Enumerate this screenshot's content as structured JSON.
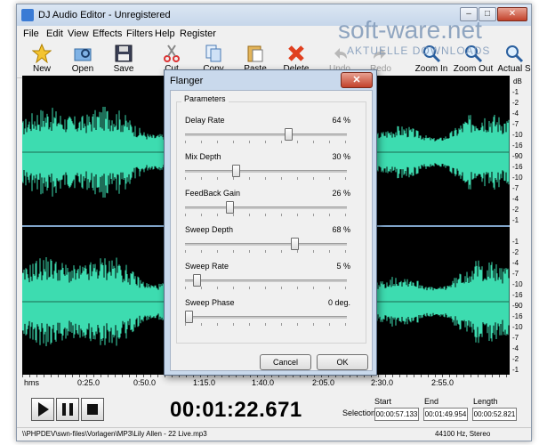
{
  "window": {
    "title": "DJ Audio Editor - Unregistered",
    "caption_buttons": [
      "–",
      "□",
      "✕"
    ]
  },
  "menu": [
    "File",
    "Edit",
    "View",
    "Effects",
    "Filters",
    "Help",
    "Register"
  ],
  "toolbar": [
    {
      "label": "New",
      "icon": "star-new-icon",
      "enabled": true
    },
    {
      "label": "Open",
      "icon": "open-folder-icon",
      "enabled": true
    },
    {
      "label": "Save",
      "icon": "floppy-disk-icon",
      "enabled": true
    },
    {
      "label": "Cut",
      "icon": "scissors-icon",
      "enabled": true
    },
    {
      "label": "Copy",
      "icon": "copy-icon",
      "enabled": true
    },
    {
      "label": "Paste",
      "icon": "paste-icon",
      "enabled": true
    },
    {
      "label": "Delete",
      "icon": "delete-x-icon",
      "enabled": true
    },
    {
      "label": "Undo",
      "icon": "undo-icon",
      "enabled": false
    },
    {
      "label": "Redo",
      "icon": "redo-icon",
      "enabled": false
    },
    {
      "label": "Zoom In",
      "icon": "zoom-in-icon",
      "enabled": true
    },
    {
      "label": "Zoom Out",
      "icon": "zoom-out-icon",
      "enabled": true
    },
    {
      "label": "Actual S",
      "icon": "actual-size-icon",
      "enabled": true
    }
  ],
  "waveform": {
    "color": "#3ddcb0",
    "background": "#000000",
    "db_unit": "dB",
    "db_labels_top": [
      "-1",
      "-2",
      "-4",
      "-7",
      "-10",
      "-16",
      "-90",
      "-16",
      "-10",
      "-7",
      "-4",
      "-2",
      "-1"
    ],
    "db_labels_bottom": [
      "-1",
      "-2",
      "-4",
      "-7",
      "-10",
      "-16",
      "-90",
      "-16",
      "-10",
      "-7",
      "-4",
      "-2",
      "-1"
    ]
  },
  "timeline": {
    "unit": "hms",
    "labels": [
      "0:25.0",
      "0:50.0",
      "1:15.0",
      "1:40.0",
      "2:05.0",
      "2:30.0",
      "2:55.0"
    ]
  },
  "transport": {
    "time": "00:01:22.671",
    "selection_label": "Selection",
    "start_label": "Start",
    "end_label": "End",
    "length_label": "Length",
    "start": "00:00:57.133",
    "end": "00:01:49.954",
    "length": "00:00:52.821"
  },
  "status": {
    "path": "\\\\PHPDEV\\swn-files\\Vorlagen\\MP3\\Lily Allen - 22 Live.mp3",
    "format": "44100 Hz, Stereo"
  },
  "dialog": {
    "title": "Flanger",
    "group_label": "Parameters",
    "params": [
      {
        "name": "Delay Rate",
        "value": "64 %",
        "level": 0.64
      },
      {
        "name": "Mix Depth",
        "value": "30 %",
        "level": 0.3
      },
      {
        "name": "FeedBack Gain",
        "value": "26 %",
        "level": 0.26
      },
      {
        "name": "Sweep Depth",
        "value": "68 %",
        "level": 0.68
      },
      {
        "name": "Sweep Rate",
        "value": "5 %",
        "level": 0.05
      },
      {
        "name": "Sweep Phase",
        "value": "0 deg.",
        "level": 0.0
      }
    ],
    "cancel_label": "Cancel",
    "ok_label": "OK"
  },
  "watermark": {
    "brand": "soft-ware.net",
    "tagline": "AKTUELLE DOWNLOADS"
  }
}
